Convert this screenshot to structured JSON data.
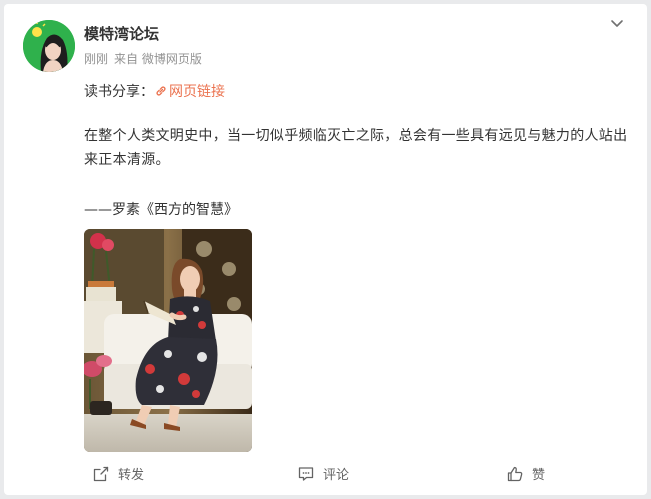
{
  "post": {
    "username": "模特湾论坛",
    "time": "刚刚",
    "source": "来自 微博网页版",
    "share_prefix": "读书分享：",
    "weblink_label": "网页链接",
    "body": "在整个人类文明史中，当一切似乎频临灭亡之际，总会有一些具有远见与魅力的人站出来正本清源。",
    "quote": "——罗素《西方的智慧》"
  },
  "actions": {
    "repost_label": "转发",
    "comment_label": "评论",
    "like_label": "赞"
  },
  "colors": {
    "link": "#eb7350",
    "avatar_bg": "#2fb14c",
    "text": "#333333",
    "meta": "#939393"
  },
  "icons": [
    "more-chevron-icon",
    "link-icon",
    "repost-icon",
    "comment-icon",
    "like-icon"
  ]
}
